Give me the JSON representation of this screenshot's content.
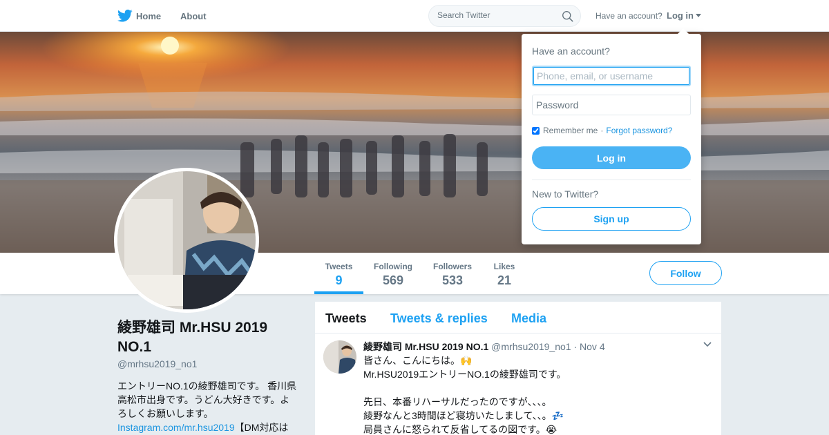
{
  "colors": {
    "brand": "#1da1f2",
    "link": "#1b95e0",
    "page_bg": "#e6ecf0",
    "muted": "#657786"
  },
  "topbar": {
    "logo_icon": "twitter-bird-icon",
    "home_label": "Home",
    "about_label": "About",
    "search_placeholder": "Search Twitter",
    "search_icon": "search-icon",
    "have_account": "Have an account?",
    "login_label": "Log in"
  },
  "login_dropdown": {
    "title": "Have an account?",
    "username_placeholder": "Phone, email, or username",
    "password_placeholder": "Password",
    "remember_checked": true,
    "remember_label": "Remember me",
    "separator": "·",
    "forgot_label": "Forgot password?",
    "login_button": "Log in",
    "new_label": "New to Twitter?",
    "signup_button": "Sign up"
  },
  "profile": {
    "name": "綾野雄司 Mr.HSU 2019 NO.1",
    "handle": "@mrhsu2019_no1",
    "bio_text": "エントリーNO.1の綾野雄司です。 香川県高松市出身です。うどん大好きです。よろしくお願いします。",
    "bio_link": "Instagram.com/mr.hsu2019",
    "bio_after": "【DM対応は"
  },
  "stats": [
    {
      "label": "Tweets",
      "value": "9",
      "active": true
    },
    {
      "label": "Following",
      "value": "569",
      "active": false
    },
    {
      "label": "Followers",
      "value": "533",
      "active": false
    },
    {
      "label": "Likes",
      "value": "21",
      "active": false
    }
  ],
  "follow_button": "Follow",
  "timeline": {
    "tabs": [
      {
        "label": "Tweets",
        "active": true
      },
      {
        "label": "Tweets & replies",
        "active": false
      },
      {
        "label": "Media",
        "active": false
      }
    ],
    "tweet": {
      "name": "綾野雄司 Mr.HSU 2019 NO.1",
      "handle": "@mrhsu2019_no1",
      "separator": "·",
      "date": "Nov 4",
      "lines": [
        "皆さん、こんにちは。🙌",
        "Mr.HSU2019エントリーNO.1の綾野雄司です。",
        "",
        "先日、本番リハーサルだったのですが、、、。",
        "綾野なんと3時間ほど寝坊いたしまして、、。💤",
        "局員さんに怒られて反省してるの図です。😭"
      ]
    }
  }
}
